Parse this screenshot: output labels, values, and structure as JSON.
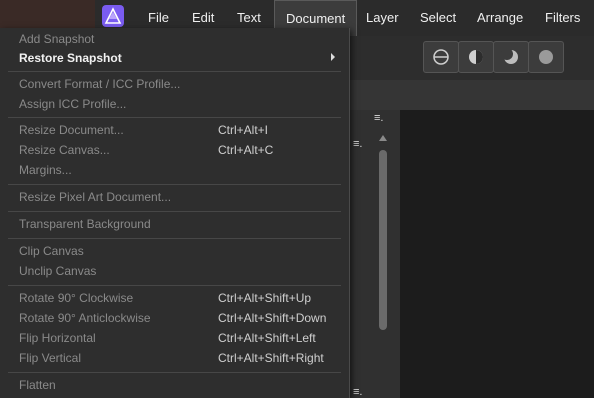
{
  "menubar": {
    "items": [
      {
        "label": "File"
      },
      {
        "label": "Edit"
      },
      {
        "label": "Text"
      },
      {
        "label": "Document",
        "active": true
      },
      {
        "label": "Layer"
      },
      {
        "label": "Select"
      },
      {
        "label": "Arrange"
      },
      {
        "label": "Filters"
      }
    ]
  },
  "document_menu": {
    "items": [
      {
        "label": "Add Snapshot",
        "enabled": false
      },
      {
        "label": "Restore Snapshot",
        "enabled": true,
        "submenu": true
      },
      {
        "label": "Convert Format / ICC Profile...",
        "enabled": false
      },
      {
        "label": "Assign ICC Profile...",
        "enabled": false
      },
      {
        "label": "Resize Document...",
        "shortcut": "Ctrl+Alt+I",
        "enabled": false
      },
      {
        "label": "Resize Canvas...",
        "shortcut": "Ctrl+Alt+C",
        "enabled": false
      },
      {
        "label": "Margins...",
        "enabled": false
      },
      {
        "label": "Resize Pixel Art Document...",
        "enabled": false
      },
      {
        "label": "Transparent Background",
        "enabled": false
      },
      {
        "label": "Clip Canvas",
        "enabled": false
      },
      {
        "label": "Unclip Canvas",
        "enabled": false
      },
      {
        "label": "Rotate 90° Clockwise",
        "shortcut": "Ctrl+Alt+Shift+Up",
        "enabled": false
      },
      {
        "label": "Rotate 90° Anticlockwise",
        "shortcut": "Ctrl+Alt+Shift+Down",
        "enabled": false
      },
      {
        "label": "Flip Horizontal",
        "shortcut": "Ctrl+Alt+Shift+Left",
        "enabled": false
      },
      {
        "label": "Flip Vertical",
        "shortcut": "Ctrl+Alt+Shift+Right",
        "enabled": false
      },
      {
        "label": "Flatten",
        "enabled": false
      }
    ]
  },
  "icons": {
    "app_logo": "affinity-photo-logo-icon",
    "panel_menu": "panel-menu-icon",
    "submenu_arrow": "chevron-right-icon",
    "toggles": [
      "split-view-icon",
      "contrast-icon",
      "moon-icon",
      "sphere-icon"
    ]
  },
  "colors": {
    "menu_bg": "#2e2e2e",
    "menubar_bg": "#2b2b2b",
    "logo": "#9c7bff",
    "disabled_text": "#8a8a8a",
    "enabled_text": "#f2f2f2"
  }
}
